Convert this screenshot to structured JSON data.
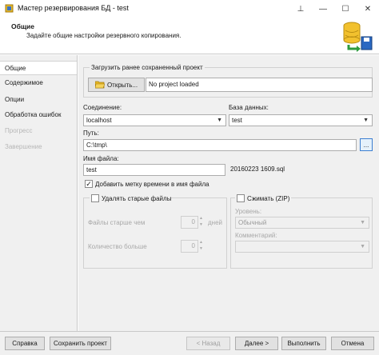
{
  "window": {
    "title": "Мастер резервирования БД - test",
    "pin_glyph": "⊥",
    "minimize_glyph": "—",
    "maximize_glyph": "☐",
    "close_glyph": "✕"
  },
  "header": {
    "title": "Общие",
    "subtitle": "Задайте общие настройки резервного копирования."
  },
  "sidebar": {
    "items": [
      {
        "label": "Общие",
        "state": "active"
      },
      {
        "label": "Содержимое",
        "state": "normal"
      },
      {
        "label": "Опции",
        "state": "normal"
      },
      {
        "label": "Обработка ошибок",
        "state": "normal"
      },
      {
        "label": "Прогресс",
        "state": "disabled"
      },
      {
        "label": "Завершение",
        "state": "disabled"
      }
    ]
  },
  "load_project": {
    "group_label": "Загрузить ранее сохраненный проект",
    "open_button": "Открыть...",
    "status": "No project loaded"
  },
  "connection": {
    "label": "Соединение:",
    "value": "localhost"
  },
  "database": {
    "label": "База данных:",
    "value": "test"
  },
  "path": {
    "label": "Путь:",
    "value": "C:\\tmp\\",
    "browse_label": "..."
  },
  "filename": {
    "label": "Имя файла:",
    "value": "test",
    "preview": "20160223 1609.sql"
  },
  "timestamp": {
    "label": "Добавить метку времени в имя файла",
    "checked": true,
    "check_glyph": "✓"
  },
  "delete_old": {
    "label": "Удалять старые файлы",
    "checked": false,
    "older_label": "Файлы старше чем",
    "older_value": "0",
    "older_unit": "дней",
    "count_label": "Количество больше",
    "count_value": "0",
    "spin_up": "▲",
    "spin_down": "▼"
  },
  "compress": {
    "label": "Сжимать (ZIP)",
    "checked": false,
    "level_label": "Уровень:",
    "level_value": "Обычный",
    "comment_label": "Комментарий:",
    "comment_value": ""
  },
  "footer": {
    "help": "Справка",
    "save_project": "Сохранить проект",
    "back": "< Назад",
    "next": "Далее >",
    "run": "Выполнить",
    "cancel": "Отмена"
  },
  "colors": {
    "accent": "#2c6fb5",
    "icon_db": "#f2c12e",
    "icon_arrow": "#2e9b3f"
  }
}
